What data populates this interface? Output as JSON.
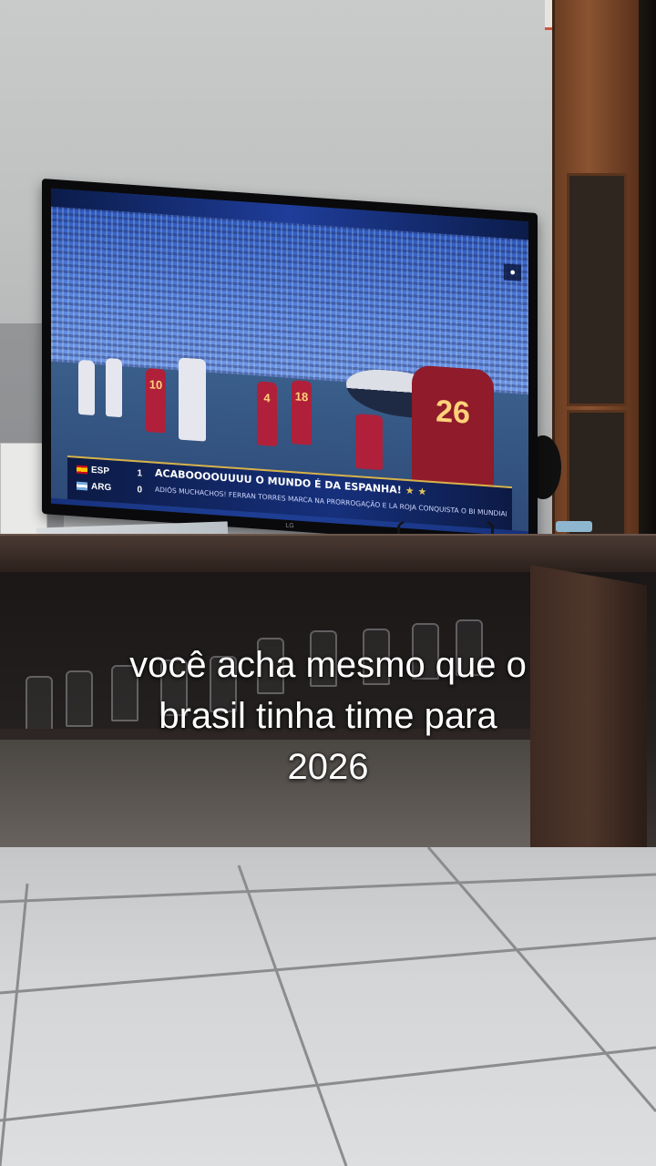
{
  "caption": {
    "lines": [
      "você acha mesmo que o",
      "brasil tinha time para",
      "2026"
    ]
  },
  "tv": {
    "brand": "LG",
    "scoreboard": {
      "teams": [
        {
          "code": "ESP",
          "score": "1"
        },
        {
          "code": "ARG",
          "score": "0"
        }
      ]
    },
    "headline": "ACABOOOOUUUU O MUNDO É DA ESPANHA!",
    "ticker": "ADIÓS MUCHACHOS! FERRAN TORRES MARCA NA PRORROGAÇÃO E LA ROJA CONQUISTA O BI MUNDIAL",
    "jersey_numbers": [
      "10",
      "4",
      "18",
      "26"
    ]
  },
  "colors": {
    "caption_text": "#ffffff",
    "tv_overlay": "#16307c",
    "spain_red": "#b0203a"
  }
}
